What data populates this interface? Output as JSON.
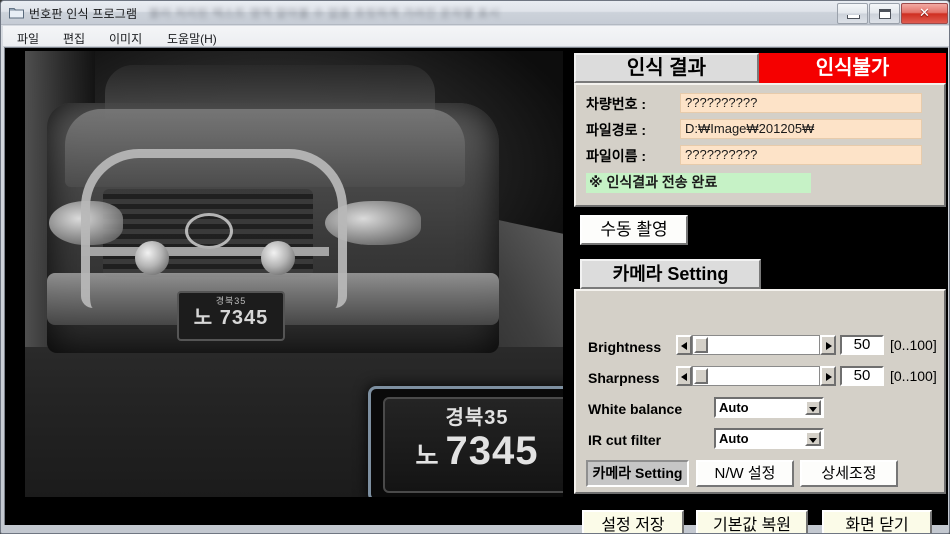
{
  "window": {
    "title": "번호판 인식 프로그램",
    "title_ghost": "블러 처리된 텍스트 영역 알아볼 수 없음 흐릿하게 가려진 문자열 표시",
    "icon": "folder-icon",
    "controls": {
      "minimize": "minimize-icon",
      "maximize": "maximize-icon",
      "close": "✕"
    }
  },
  "menubar": {
    "items": [
      {
        "label": "파일"
      },
      {
        "label": "편집"
      },
      {
        "label": "이미지"
      },
      {
        "label": "도움말(H)"
      }
    ]
  },
  "video": {
    "plate_inset": {
      "region": "경북35",
      "hangul": "노",
      "digits": "7345"
    },
    "plate_on_car": {
      "region": "경북35",
      "number": "노 7345"
    }
  },
  "result": {
    "header": "인식 결과",
    "badge": "인식불가",
    "badge_color": "#f50000",
    "fields": [
      {
        "label": "차량번호 :",
        "value": "??????????"
      },
      {
        "label": "파일경로 :",
        "value": "D:₩Image₩201205₩"
      },
      {
        "label": "파일이름 :",
        "value": "??????????"
      }
    ],
    "status": "※ 인식결과 전송 완료",
    "status_color": "#c6f2c6",
    "manual_capture_button": "수동 촬영"
  },
  "camera": {
    "header": "카메라 Setting",
    "sliders": [
      {
        "label": "Brightness",
        "value": "50",
        "range": "[0..100]",
        "percent": 50
      },
      {
        "label": "Sharpness",
        "value": "50",
        "range": "[0..100]",
        "percent": 50
      }
    ],
    "combos": [
      {
        "label": "White balance",
        "value": "Auto"
      },
      {
        "label": "IR cut filter",
        "value": "Auto"
      }
    ],
    "tabs": [
      {
        "label": "카메라 Setting",
        "active": true
      },
      {
        "label": "N/W 설정",
        "active": false
      },
      {
        "label": "상세조정",
        "active": false
      }
    ]
  },
  "footer": {
    "buttons": [
      {
        "label": "설정 저장"
      },
      {
        "label": "기본값 복원"
      },
      {
        "label": "화면 닫기"
      }
    ]
  }
}
